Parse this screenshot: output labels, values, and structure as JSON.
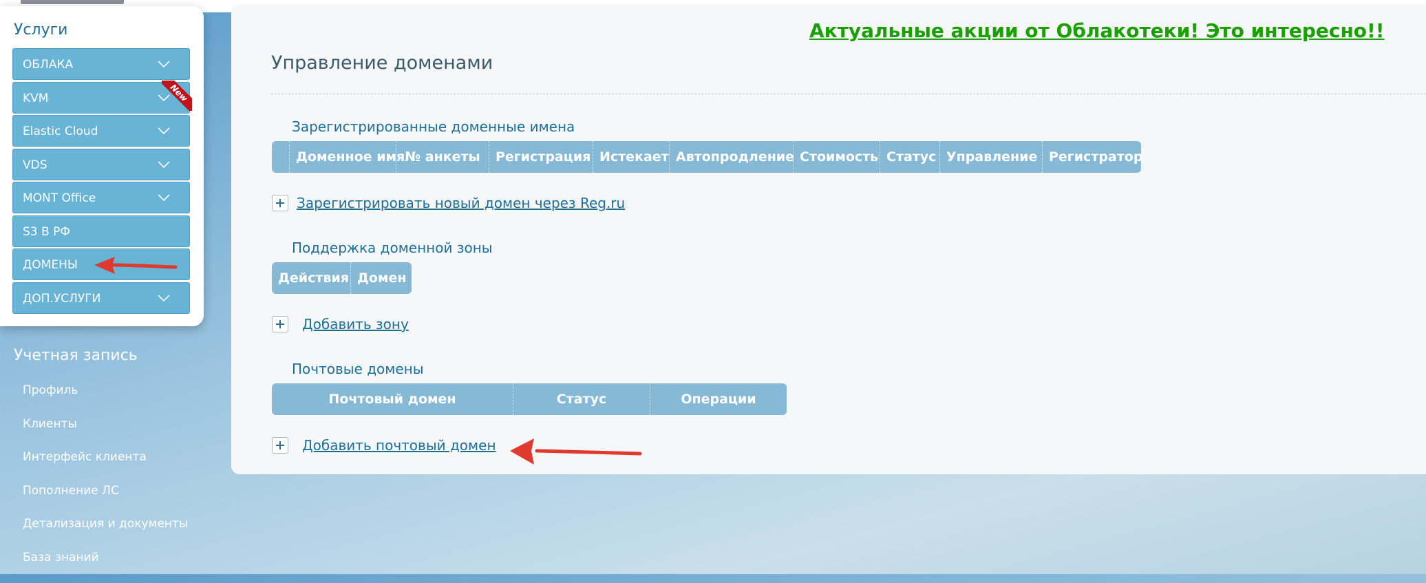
{
  "sidebar": {
    "services_title": "Услуги",
    "services": [
      {
        "label": "ОБЛАКА",
        "has_chevron": true
      },
      {
        "label": "KVM",
        "has_chevron": true,
        "badge": "New"
      },
      {
        "label": "Elastic Cloud",
        "has_chevron": true
      },
      {
        "label": "VDS",
        "has_chevron": true
      },
      {
        "label": "MONT Office",
        "has_chevron": true
      },
      {
        "label": "S3 В РФ",
        "has_chevron": false
      },
      {
        "label": "ДОМЕНЫ",
        "has_chevron": false
      },
      {
        "label": "ДОП.УСЛУГИ",
        "has_chevron": true
      }
    ],
    "account_title": "Учетная запись",
    "account_items": [
      {
        "label": "Профиль"
      },
      {
        "label": "Клиенты"
      },
      {
        "label": "Интерфейс клиента"
      },
      {
        "label": "Пополнение ЛС"
      },
      {
        "label": "Детализация и документы"
      },
      {
        "label": "База знаний"
      }
    ]
  },
  "main": {
    "promo_link": "Актуальные акции от Облакотеки! Это интересно!!",
    "page_title": "Управление доменами",
    "registered": {
      "title": "Зарегистрированные доменные имена",
      "columns": [
        "Доменное имя",
        "№ анкеты",
        "Регистрация",
        "Истекает",
        "Автопродление",
        "Стоимость",
        "Статус",
        "Управление",
        "Регистратор"
      ],
      "add_link": "Зарегистрировать новый домен через Reg.ru"
    },
    "zone": {
      "title": "Поддержка доменной зоны",
      "columns": [
        "Действия",
        "Домен"
      ],
      "add_link": "Добавить зону"
    },
    "mail": {
      "title": "Почтовые домены",
      "columns": [
        "Почтовый домен",
        "Статус",
        "Операции"
      ],
      "add_link": "Добавить почтовый домен"
    }
  },
  "colors": {
    "menu_item_bg": "#67b4d7",
    "table_header_bg": "#85b9d6",
    "link": "#1d6f9c",
    "promo": "#1aa000",
    "annotation_arrow": "#e03a2f"
  }
}
